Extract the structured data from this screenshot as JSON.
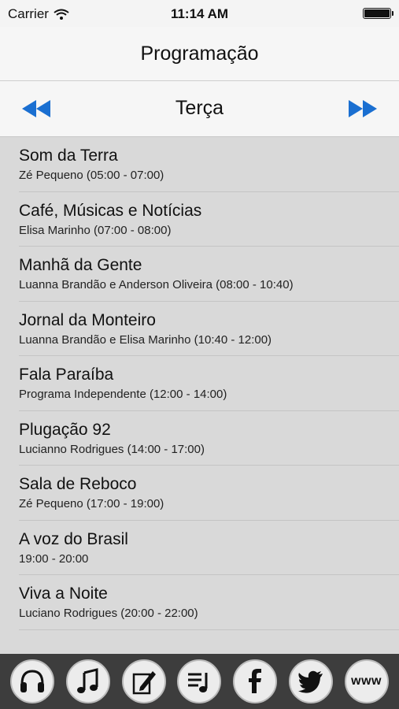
{
  "status": {
    "carrier": "Carrier",
    "time": "11:14 AM"
  },
  "nav": {
    "title": "Programação"
  },
  "day": {
    "label": "Terça"
  },
  "colors": {
    "accent": "#1a6fd1",
    "tabbar": "#3d3d3d"
  },
  "programs": [
    {
      "title": "Som da Terra",
      "subtitle": "Zé Pequeno (05:00 - 07:00)"
    },
    {
      "title": "Café, Músicas e Notícias",
      "subtitle": "Elisa Marinho (07:00 - 08:00)"
    },
    {
      "title": "Manhã da Gente",
      "subtitle": "Luanna Brandão e Anderson Oliveira (08:00 - 10:40)"
    },
    {
      "title": "Jornal da Monteiro",
      "subtitle": "Luanna Brandão e Elisa Marinho  (10:40 - 12:00)"
    },
    {
      "title": "Fala Paraíba",
      "subtitle": "Programa Independente (12:00 - 14:00)"
    },
    {
      "title": "Plugação 92",
      "subtitle": "Lucianno Rodrigues  (14:00 - 17:00)"
    },
    {
      "title": "Sala de Reboco",
      "subtitle": "Zé Pequeno (17:00 - 19:00)"
    },
    {
      "title": "A voz do Brasil",
      "subtitle": "19:00 - 20:00"
    },
    {
      "title": "Viva a Noite",
      "subtitle": "Luciano Rodrigues (20:00 - 22:00)"
    }
  ],
  "tabs": [
    {
      "icon": "headphones-icon"
    },
    {
      "icon": "music-note-icon"
    },
    {
      "icon": "pencil-edit-icon"
    },
    {
      "icon": "playlist-icon"
    },
    {
      "icon": "facebook-icon"
    },
    {
      "icon": "twitter-icon"
    },
    {
      "icon": "www-icon",
      "label": "www"
    }
  ]
}
